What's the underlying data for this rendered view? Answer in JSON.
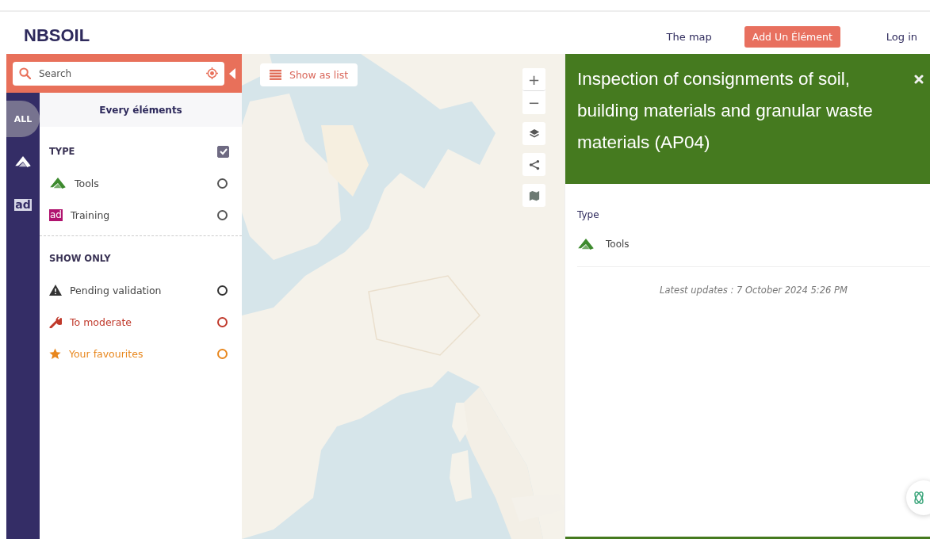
{
  "header": {
    "logo": "NBSOIL",
    "nav": [
      {
        "kind": "link",
        "label": "The map"
      },
      {
        "kind": "button",
        "label": "Add Un Élément"
      },
      {
        "kind": "link",
        "label": "Log in"
      }
    ]
  },
  "sidebar": {
    "search": {
      "placeholder": "Search"
    },
    "tabs": [
      {
        "kind": "all",
        "label": "ALL",
        "selected": true
      },
      {
        "kind": "tools",
        "selected": false
      },
      {
        "kind": "training",
        "label": "ad",
        "selected": false
      }
    ],
    "title": "Every éléments",
    "type_section": {
      "heading": "TYPE",
      "checked": true,
      "items": [
        {
          "kind": "tools",
          "label": "Tools",
          "checked": false
        },
        {
          "kind": "training",
          "badge": "ad",
          "label": "Training",
          "checked": false
        }
      ]
    },
    "show_only": {
      "heading": "SHOW ONLY",
      "items": [
        {
          "kind": "pending",
          "label": "Pending validation",
          "color": "#333333",
          "checked": false
        },
        {
          "kind": "moderate",
          "label": "To moderate",
          "color": "#c0392b",
          "checked": false
        },
        {
          "kind": "favourite",
          "label": "Your favourites",
          "color": "#e8871e",
          "checked": false
        }
      ]
    }
  },
  "map": {
    "kind": "picture",
    "list_button": "Show as list",
    "controls": [
      {
        "kind": "zoom_in",
        "label": "+"
      },
      {
        "kind": "zoom_out",
        "label": "−"
      },
      {
        "kind": "layers"
      },
      {
        "kind": "share"
      },
      {
        "kind": "basemap"
      }
    ]
  },
  "detail": {
    "title": "Inspection of consignments of soil, building materials and granular waste materials (AP04)",
    "type_label": "Type",
    "type_value": {
      "kind": "tools",
      "label": "Tools"
    },
    "updated": "Latest updates : 7 October 2024 5:26 PM"
  }
}
